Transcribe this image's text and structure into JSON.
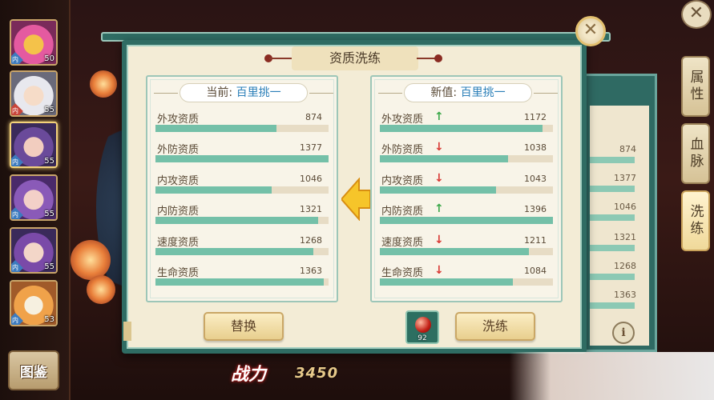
{
  "dialog": {
    "title": "资质洗练",
    "close_icon": "close-icon"
  },
  "current_panel": {
    "header_label": "当前:",
    "header_value": "百里挑一",
    "stats": [
      {
        "name": "外攻资质",
        "value": "874",
        "fill": 0.7
      },
      {
        "name": "外防资质",
        "value": "1377",
        "fill": 1.0
      },
      {
        "name": "内攻资质",
        "value": "1046",
        "fill": 0.67
      },
      {
        "name": "内防资质",
        "value": "1321",
        "fill": 0.94
      },
      {
        "name": "速度资质",
        "value": "1268",
        "fill": 0.91
      },
      {
        "name": "生命资质",
        "value": "1363",
        "fill": 0.97
      }
    ]
  },
  "new_panel": {
    "header_label": "新值:",
    "header_value": "百里挑一",
    "stats": [
      {
        "name": "外攻资质",
        "value": "1172",
        "trend": "up",
        "fill": 0.94
      },
      {
        "name": "外防资质",
        "value": "1038",
        "trend": "down",
        "fill": 0.74
      },
      {
        "name": "内攻资质",
        "value": "1043",
        "trend": "down",
        "fill": 0.67
      },
      {
        "name": "内防资质",
        "value": "1396",
        "trend": "up",
        "fill": 1.0
      },
      {
        "name": "速度资质",
        "value": "1211",
        "trend": "down",
        "fill": 0.86
      },
      {
        "name": "生命资质",
        "value": "1084",
        "trend": "down",
        "fill": 0.77
      }
    ]
  },
  "buttons": {
    "replace": "替换",
    "refine": "洗练"
  },
  "item": {
    "count": "92"
  },
  "power": {
    "label": "战力",
    "value": "3450"
  },
  "side_tabs": [
    "属性",
    "血脉",
    "洗练"
  ],
  "gallery_button": "图鉴",
  "heroes": [
    {
      "level": "50",
      "tag": "内"
    },
    {
      "level": "55",
      "tag": "内"
    },
    {
      "level": "55",
      "tag": "内"
    },
    {
      "level": "55",
      "tag": "内"
    },
    {
      "level": "55",
      "tag": "内"
    },
    {
      "level": "53",
      "tag": "内"
    }
  ],
  "background_values": [
    "874",
    "1377",
    "1046",
    "1321",
    "1268",
    "1363"
  ],
  "colors": {
    "frame": "#2f6c63",
    "bar": "#74c0a8",
    "arrow_up": "#3ca84a",
    "arrow_down": "#d93a35",
    "highlight": "#2b7fb8"
  }
}
